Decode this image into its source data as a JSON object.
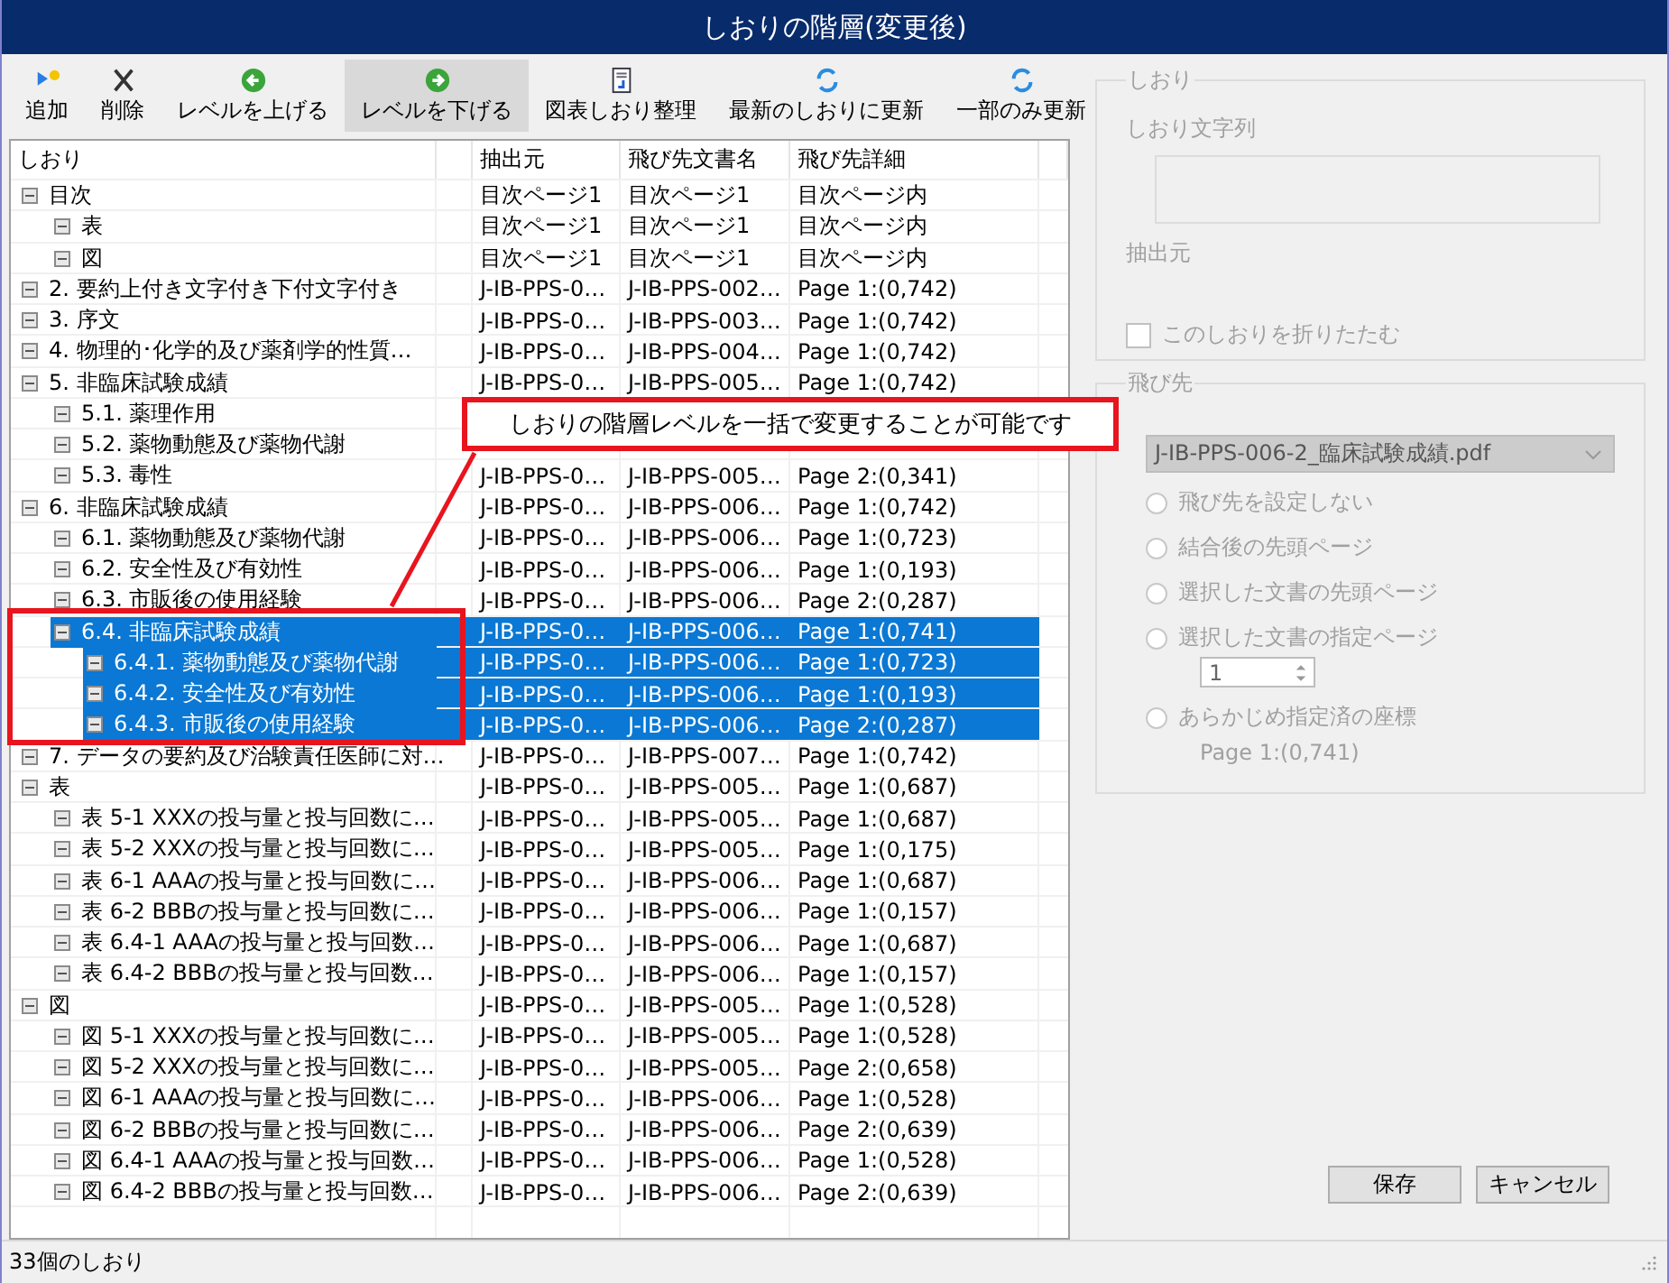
{
  "window": {
    "title": "しおりの階層(変更後)"
  },
  "toolbar": [
    {
      "label": "追加",
      "highlighted": false
    },
    {
      "label": "削除",
      "highlighted": false
    },
    {
      "label": "レベルを上げる",
      "highlighted": false
    },
    {
      "label": "レベルを下げる",
      "highlighted": true
    },
    {
      "label": "図表しおり整理",
      "highlighted": false
    },
    {
      "label": "最新のしおりに更新",
      "highlighted": false
    },
    {
      "label": "一部のみ更新",
      "highlighted": false
    }
  ],
  "table": {
    "columns": [
      "しおり",
      "抽出元",
      "飛び先文書名",
      "飛び先詳細"
    ],
    "rows": [
      {
        "label": "目次",
        "source": "目次ページ1",
        "document": "目次ページ1",
        "detail": "目次ページ内",
        "selected": false,
        "children": [
          {
            "label": "表",
            "source": "目次ページ1",
            "document": "目次ページ1",
            "detail": "目次ページ内",
            "selected": false
          },
          {
            "label": "図",
            "source": "目次ページ1",
            "document": "目次ページ1",
            "detail": "目次ページ内",
            "selected": false
          }
        ]
      },
      {
        "label": "2. 要約上付き文字付き下付文字付き",
        "source": "J-IB-PPS-0…",
        "document": "J-IB-PPS-002…",
        "detail": "Page 1:(0,742)",
        "selected": false
      },
      {
        "label": "3. 序文",
        "source": "J-IB-PPS-0…",
        "document": "J-IB-PPS-003…",
        "detail": "Page 1:(0,742)",
        "selected": false
      },
      {
        "label": "4. 物理的･化学的及び薬剤学的性質…",
        "source": "J-IB-PPS-0…",
        "document": "J-IB-PPS-004…",
        "detail": "Page 1:(0,742)",
        "selected": false
      },
      {
        "label": "5. 非臨床試験成績",
        "source": "J-IB-PPS-0…",
        "document": "J-IB-PPS-005…",
        "detail": "Page 1:(0,742)",
        "selected": false,
        "children": [
          {
            "label": "5.1. 薬理作用",
            "selected": false
          },
          {
            "label": "5.2. 薬物動態及び薬物代謝",
            "selected": false
          },
          {
            "label": "5.3. 毒性",
            "source": "J-IB-PPS-0…",
            "document": "J-IB-PPS-005…",
            "detail": "Page 2:(0,341)",
            "selected": false
          }
        ]
      },
      {
        "label": "6. 非臨床試験成績",
        "source": "J-IB-PPS-0…",
        "document": "J-IB-PPS-006…",
        "detail": "Page 1:(0,742)",
        "selected": false,
        "children": [
          {
            "label": "6.1. 薬物動態及び薬物代謝",
            "source": "J-IB-PPS-0…",
            "document": "J-IB-PPS-006…",
            "detail": "Page 1:(0,723)",
            "selected": false
          },
          {
            "label": "6.2. 安全性及び有効性",
            "source": "J-IB-PPS-0…",
            "document": "J-IB-PPS-006…",
            "detail": "Page 1:(0,193)",
            "selected": false
          },
          {
            "label": "6.3. 市販後の使用経験",
            "source": "J-IB-PPS-0…",
            "document": "J-IB-PPS-006…",
            "detail": "Page 2:(0,287)",
            "selected": false
          },
          {
            "label": "6.4. 非臨床試験成績",
            "source": "J-IB-PPS-0…",
            "document": "J-IB-PPS-006…",
            "detail": "Page 1:(0,741)",
            "selected": true,
            "children": [
              {
                "label": "6.4.1. 薬物動態及び薬物代謝",
                "source": "J-IB-PPS-0…",
                "document": "J-IB-PPS-006…",
                "detail": "Page 1:(0,723)",
                "selected": true
              },
              {
                "label": "6.4.2. 安全性及び有効性",
                "source": "J-IB-PPS-0…",
                "document": "J-IB-PPS-006…",
                "detail": "Page 1:(0,193)",
                "selected": true
              },
              {
                "label": "6.4.3. 市販後の使用経験",
                "source": "J-IB-PPS-0…",
                "document": "J-IB-PPS-006…",
                "detail": "Page 2:(0,287)",
                "selected": true
              }
            ]
          }
        ]
      },
      {
        "label": "7. データの要約及び治験責任医師に対…",
        "source": "J-IB-PPS-0…",
        "document": "J-IB-PPS-007…",
        "detail": "Page 1:(0,742)",
        "selected": false
      },
      {
        "label": "表",
        "source": "J-IB-PPS-0…",
        "document": "J-IB-PPS-005…",
        "detail": "Page 1:(0,687)",
        "selected": false,
        "children": [
          {
            "label": "表 5-1 XXXの投与量と投与回数に…",
            "source": "J-IB-PPS-0…",
            "document": "J-IB-PPS-005…",
            "detail": "Page 1:(0,687)",
            "selected": false
          },
          {
            "label": "表 5-2 XXXの投与量と投与回数に…",
            "source": "J-IB-PPS-0…",
            "document": "J-IB-PPS-005…",
            "detail": "Page 1:(0,175)",
            "selected": false
          },
          {
            "label": "表 6-1 AAAの投与量と投与回数に…",
            "source": "J-IB-PPS-0…",
            "document": "J-IB-PPS-006…",
            "detail": "Page 1:(0,687)",
            "selected": false
          },
          {
            "label": "表 6-2 BBBの投与量と投与回数に…",
            "source": "J-IB-PPS-0…",
            "document": "J-IB-PPS-006…",
            "detail": "Page 1:(0,157)",
            "selected": false
          },
          {
            "label": "表 6.4-1 AAAの投与量と投与回数…",
            "source": "J-IB-PPS-0…",
            "document": "J-IB-PPS-006…",
            "detail": "Page 1:(0,687)",
            "selected": false
          },
          {
            "label": "表 6.4-2 BBBの投与量と投与回数…",
            "source": "J-IB-PPS-0…",
            "document": "J-IB-PPS-006…",
            "detail": "Page 1:(0,157)",
            "selected": false
          }
        ]
      },
      {
        "label": "図",
        "source": "J-IB-PPS-0…",
        "document": "J-IB-PPS-005…",
        "detail": "Page 1:(0,528)",
        "selected": false,
        "children": [
          {
            "label": "図 5-1 XXXの投与量と投与回数に…",
            "source": "J-IB-PPS-0…",
            "document": "J-IB-PPS-005…",
            "detail": "Page 1:(0,528)",
            "selected": false
          },
          {
            "label": "図 5-2 XXXの投与量と投与回数に…",
            "source": "J-IB-PPS-0…",
            "document": "J-IB-PPS-005…",
            "detail": "Page 2:(0,658)",
            "selected": false
          },
          {
            "label": "図 6-1 AAAの投与量と投与回数に…",
            "source": "J-IB-PPS-0…",
            "document": "J-IB-PPS-006…",
            "detail": "Page 1:(0,528)",
            "selected": false
          },
          {
            "label": "図 6-2 BBBの投与量と投与回数に…",
            "source": "J-IB-PPS-0…",
            "document": "J-IB-PPS-006…",
            "detail": "Page 2:(0,639)",
            "selected": false
          },
          {
            "label": "図 6.4-1 AAAの投与量と投与回数…",
            "source": "J-IB-PPS-0…",
            "document": "J-IB-PPS-006…",
            "detail": "Page 1:(0,528)",
            "selected": false
          },
          {
            "label": "図 6.4-2 BBBの投与量と投与回数…",
            "source": "J-IB-PPS-0…",
            "document": "J-IB-PPS-006…",
            "detail": "Page 2:(0,639)",
            "selected": false
          }
        ]
      }
    ]
  },
  "callout": {
    "text": "しおりの階層レベルを一括で変更することが可能です"
  },
  "bookmark_group": {
    "title": "しおり",
    "text_label": "しおり文字列",
    "source_label": "抽出元",
    "collapse_checkbox": {
      "label": "このしおりを折りたたむ",
      "checked": false
    }
  },
  "destination_group": {
    "title": "飛び先",
    "document": "J-IB-PPS-006-2_臨床試験成績.pdf",
    "options": [
      {
        "label": "飛び先を設定しない",
        "selected": false
      },
      {
        "label": "結合後の先頭ページ",
        "selected": false
      },
      {
        "label": "選択した文書の先頭ページ",
        "selected": false
      },
      {
        "label": "選択した文書の指定ページ",
        "selected": false
      },
      {
        "label": "あらかじめ指定済の座標",
        "selected": false
      }
    ],
    "page_number": "1",
    "coordinate": "Page 1:(0,741)"
  },
  "buttons": [
    "保存",
    "キャンセル"
  ],
  "status_bar": "33個のしおり"
}
